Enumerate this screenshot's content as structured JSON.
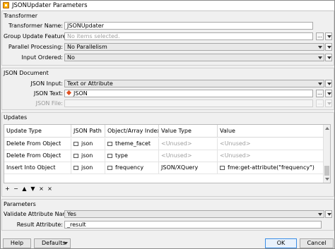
{
  "window": {
    "title": "JSONUpdater Parameters"
  },
  "transformer": {
    "section": "Transformer",
    "name_label": "Transformer Name:",
    "name_value": "JSONUpdater",
    "group_label": "Group Update Features By:",
    "group_placeholder": "No items selected.",
    "parallel_label": "Parallel Processing:",
    "parallel_value": "No Parallelism",
    "ordered_label": "Input Ordered:",
    "ordered_value": "No"
  },
  "json_document": {
    "section": "JSON Document",
    "input_label": "JSON Input:",
    "input_value": "Text or Attribute",
    "text_label": "JSON Text:",
    "text_value": "JSON",
    "file_label": "JSON File:"
  },
  "updates": {
    "section": "Updates",
    "columns": [
      "Update Type",
      "JSON Path",
      "Object/Array Index",
      "Value Type",
      "Value"
    ],
    "rows": [
      [
        "Delete From Object",
        "json",
        "theme_facet",
        "<Unused>",
        "<Unused>"
      ],
      [
        "Delete From Object",
        "json",
        "type",
        "<Unused>",
        "<Unused>"
      ],
      [
        "Insert Into Object",
        "json",
        "frequency",
        "JSON/XQuery",
        "fme:get-attribute(\"frequency\")"
      ]
    ],
    "row_controls": [
      "+",
      "−",
      "▲",
      "▼",
      "×",
      "×"
    ]
  },
  "parameters": {
    "section": "Parameters",
    "validate_label": "Validate Attribute Names:",
    "validate_value": "Yes",
    "result_label": "Result Attribute:",
    "result_value": "_result"
  },
  "footer": {
    "help": "Help",
    "defaults": "Defaults",
    "ok": "OK",
    "cancel": "Cancel"
  },
  "icons": {
    "ellipsis": "...",
    "app": "fme-transformer-icon",
    "json_text": "attribute-value-icon",
    "cell": "text-cell-icon"
  },
  "colors": {
    "window_bg": "#f0f0f0",
    "accent": "#3a8ee6",
    "json_icon": "#e05020"
  }
}
